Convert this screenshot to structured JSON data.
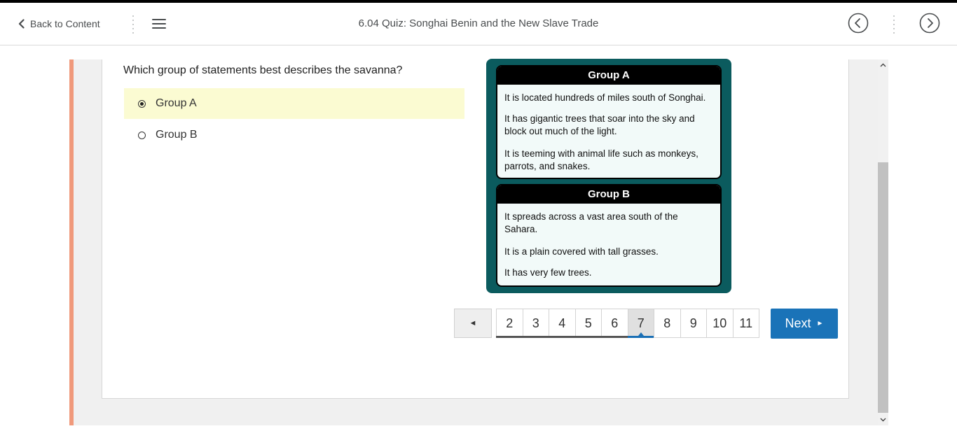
{
  "nav": {
    "back_label": "Back to Content",
    "title": "6.04 Quiz: Songhai Benin and the New Slave Trade"
  },
  "question": {
    "text": "Which group of statements best describes the savanna?",
    "options": [
      {
        "label": "Group A",
        "selected": true
      },
      {
        "label": "Group B",
        "selected": false
      }
    ]
  },
  "groups": [
    {
      "title": "Group A",
      "statements": [
        "It is located hundreds of miles south of Songhai.",
        "It has gigantic trees that soar into the sky and block out much of the light.",
        "It is teeming with animal life such as monkeys, parrots, and snakes."
      ]
    },
    {
      "title": "Group B",
      "statements": [
        "It spreads across a vast area south of the Sahara.",
        "It is a plain covered with tall grasses.",
        "It has very few trees."
      ]
    }
  ],
  "pager": {
    "prev_symbol": "◄",
    "pages": [
      "2",
      "3",
      "4",
      "5",
      "6",
      "7",
      "8",
      "9",
      "10",
      "11"
    ],
    "current": "7",
    "next_label": "Next",
    "next_symbol": "►"
  },
  "colors": {
    "accent_left": "#f0997b",
    "card_frame": "#0b5b5e",
    "next_button": "#1a73b8",
    "selected_option_bg": "#fbfbd2"
  }
}
